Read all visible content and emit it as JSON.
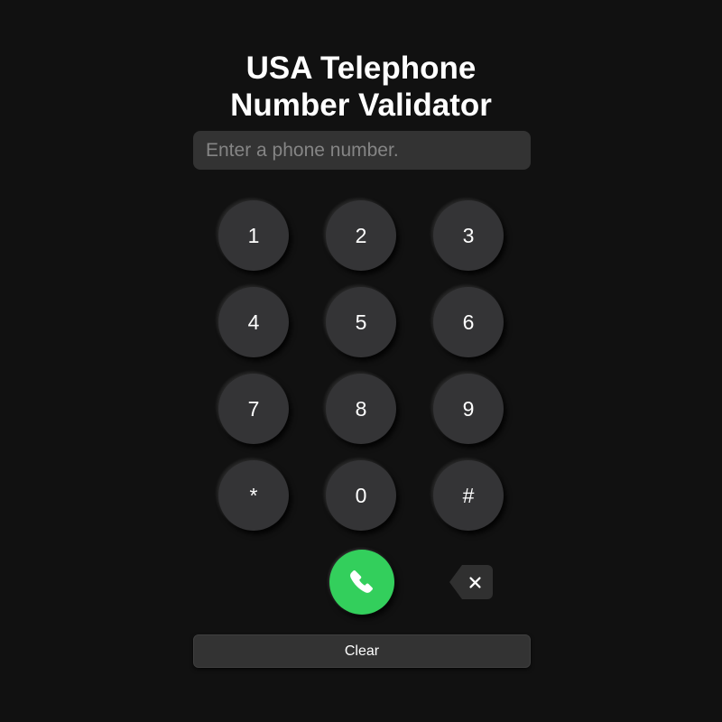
{
  "app": {
    "background_color": "#111111",
    "title": "USA Telephone\nNumber Validator"
  },
  "input": {
    "name": "phone-number-input",
    "value": "",
    "placeholder": "Enter a phone number."
  },
  "keypad": {
    "keys": [
      {
        "label": "1",
        "name": "key-1"
      },
      {
        "label": "2",
        "name": "key-2"
      },
      {
        "label": "3",
        "name": "key-3"
      },
      {
        "label": "4",
        "name": "key-4"
      },
      {
        "label": "5",
        "name": "key-5"
      },
      {
        "label": "6",
        "name": "key-6"
      },
      {
        "label": "7",
        "name": "key-7"
      },
      {
        "label": "8",
        "name": "key-8"
      },
      {
        "label": "9",
        "name": "key-9"
      },
      {
        "label": "*",
        "name": "key-star"
      },
      {
        "label": "0",
        "name": "key-0"
      },
      {
        "label": "#",
        "name": "key-hash"
      }
    ]
  },
  "actions": {
    "call": {
      "icon": "phone-handset-icon",
      "color": "#33cf5c",
      "label": ""
    },
    "backspace": {
      "icon": "backspace-x-icon",
      "color": "#303030",
      "label": ""
    }
  },
  "clear": {
    "label": "Clear"
  },
  "colors": {
    "background": "#111111",
    "surface": "#333333",
    "key": "#343436",
    "accent_green": "#33cf5c",
    "text": "#ffffff",
    "placeholder": "#858585"
  }
}
